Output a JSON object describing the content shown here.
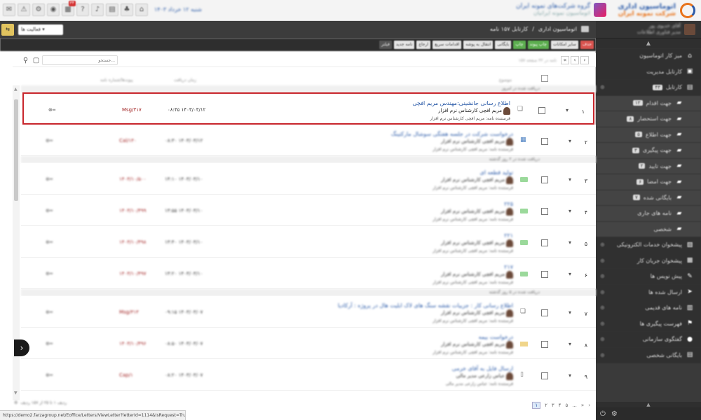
{
  "header": {
    "brand_title": "اتوماسیون اداری",
    "brand_subtitle": "شرکت نمونه ایران",
    "org_title": "گروه شرکت‌های نمونه ایران",
    "org_subtitle": "اتوماسیون نمونه ایرانیان",
    "date_text": "شنبه ۱۲ خرداد ۱۴۰۳",
    "icons": [
      "envelope-icon",
      "network-icon",
      "gear-icon",
      "eye-icon",
      "calendar-icon",
      "help-icon",
      "mic-icon",
      "table-icon",
      "bell-icon",
      "home-icon"
    ],
    "notification_badge": "۳۴"
  },
  "sidebar": {
    "user_name": "آقای خدیوی پور",
    "user_role": "مدیر فناوری اطلاعات",
    "items": [
      {
        "label": "میز کار اتوماسیون",
        "icon": "home-icon",
        "type": "sect"
      },
      {
        "label": "کارتابل مدیریت",
        "icon": "briefcase-icon",
        "type": "sect"
      },
      {
        "label": "کارتابل",
        "icon": "inbox-icon",
        "type": "sect",
        "count": "۴۳"
      },
      {
        "label": "جهت اقدام",
        "icon": "folder-icon",
        "type": "sub",
        "count": "۱۲"
      },
      {
        "label": "جهت استحضار",
        "icon": "folder-icon",
        "type": "sub",
        "count": "۸"
      },
      {
        "label": "جهت اطلاع",
        "icon": "folder-icon",
        "type": "sub",
        "count": "۵"
      },
      {
        "label": "جهت پیگیری",
        "icon": "folder-icon",
        "type": "sub",
        "count": "۳"
      },
      {
        "label": "جهت تایید",
        "icon": "folder-icon",
        "type": "sub",
        "count": "۲"
      },
      {
        "label": "جهت امضا",
        "icon": "folder-icon",
        "type": "sub",
        "count": "۶"
      },
      {
        "label": "بایگانی شده",
        "icon": "folder-icon",
        "type": "sub",
        "count": "۷"
      },
      {
        "label": "نامه های جاری",
        "icon": "folder-icon",
        "type": "sub"
      },
      {
        "label": "شخصی",
        "icon": "folder-icon",
        "type": "sub"
      },
      {
        "label": "پیشخوان خدمات الکترونیکی",
        "icon": "services-icon",
        "type": "sect"
      },
      {
        "label": "پیشخوان جریان کار",
        "icon": "grid-icon",
        "type": "sect"
      },
      {
        "label": "پیش نویس ها",
        "icon": "edit-icon",
        "type": "sect"
      },
      {
        "label": "ارسال شده ها",
        "icon": "send-icon",
        "type": "sect"
      },
      {
        "label": "نامه های قدیمی",
        "icon": "archive-icon",
        "type": "sect"
      },
      {
        "label": "فهرست پیگیری ها",
        "icon": "flag-icon",
        "type": "sect"
      },
      {
        "label": "گفتگوی سازمانی",
        "icon": "chat-icon",
        "type": "sect"
      },
      {
        "label": "بایگانی شخصی",
        "icon": "cabinet-icon",
        "type": "sect"
      }
    ]
  },
  "pathbar": {
    "context_button": "فعالیت ها",
    "crumb1": "اتوماسیون اداری",
    "crumb2": "کارتابل ۱۵۷ نامه"
  },
  "toolbar": {
    "buttons": [
      {
        "label": "فیلتر",
        "style": "dark"
      },
      {
        "label": "نامه جدید",
        "style": "light"
      },
      {
        "label": "ارجاع",
        "style": "light"
      },
      {
        "label": "اقدامات سریع",
        "style": "light"
      },
      {
        "label": "انتقال به پوشه",
        "style": "light"
      },
      {
        "label": "بایگانی",
        "style": "light"
      },
      {
        "label": "چاپ",
        "style": "green"
      },
      {
        "label": "چاپ پیوند",
        "style": "green"
      },
      {
        "label": "سایر امکانات",
        "style": "light"
      },
      {
        "label": "حذف",
        "style": "red"
      }
    ]
  },
  "search": {
    "placeholder": "جستجو...",
    "pager_text": "۱۵۷ نامه در ۳۲ صفحه"
  },
  "columns": {
    "subject": "موضوع",
    "date": "زمان دریافت",
    "number": "پیوندها/شماره نامه"
  },
  "groups": [
    {
      "label": "دریافت شده در امروز"
    },
    {
      "label": "دریافت شده در ۲ روز گذشته"
    },
    {
      "label": "دریافت شده در ۵ روز گذشته"
    }
  ],
  "rows": [
    {
      "num": "۱",
      "title": "اطلاع رسانی جانشینی:مهندس مریم افچی",
      "sender": "مریم افچی کارشناس نرم افزار",
      "from": "فرستنده نامه: مریم افچی کارشناس نرم افزار",
      "date": "۰۸:۴۵ ۱۴۰۳/۰۳/۱۲",
      "code": "Msg/۳۱۷",
      "icon": "eye-open-icon",
      "type": "doc"
    },
    {
      "num": "۲",
      "title": "درخواست شرکت در جلسه هفتگی سوشال مارکتینگ",
      "sender": "مریم افچی کارشناس نرم افزار",
      "from": "فرستنده نامه: مریم افچی کارشناس نرم افزار",
      "date": "۰۸:۳۰ ۱۴۰۳/۰۳/۱۲",
      "code": "Cal/۱۴۰",
      "icon": "eye-open-icon",
      "type": "cal"
    },
    {
      "num": "۳",
      "title": "تولید قطعه ای",
      "sender": "مریم افچی کارشناس نرم افزار",
      "from": "فرستنده نامه: مریم افچی کارشناس نرم افزار",
      "date": "۱۴:۱۰ ۱۴۰۳/۰۳/۱۰",
      "code": "۱۴۰۳/۱۰/۵۰۰",
      "icon": "eye-open-icon",
      "type": "green"
    },
    {
      "num": "۴",
      "title": "۲۲۵",
      "sender": "مریم افچی کارشناس نرم افزار",
      "from": "فرستنده نامه: مریم افچی کارشناس نرم افزار",
      "date": "۱۳:۵۵ ۱۴۰۳/۰۳/۱۰",
      "code": "۱۴۰۳/۱۰/۴۹۹",
      "icon": "eye-open-icon",
      "type": "green"
    },
    {
      "num": "۵",
      "title": "۲۲۱",
      "sender": "مریم افچی کارشناس نرم افزار",
      "from": "فرستنده نامه: مریم افچی کارشناس نرم افزار",
      "date": "۱۳:۴۰ ۱۴۰۳/۰۳/۱۰",
      "code": "۱۴۰۳/۱۰/۴۹۸",
      "icon": "eye-open-icon",
      "type": "green"
    },
    {
      "num": "۶",
      "title": "۲۱۷",
      "sender": "مریم افچی کارشناس نرم افزار",
      "from": "فرستنده نامه: مریم افچی کارشناس نرم افزار",
      "date": "۱۳:۲۰ ۱۴۰۳/۰۳/۱۰",
      "code": "۱۴۰۳/۱۰/۴۹۷",
      "icon": "eye-open-icon",
      "type": "green"
    },
    {
      "num": "۷",
      "title": "اطلاع رسانی کار : جزییات نقشه سنگ های لاک ابلیت هال در پروژه : آرکادیا",
      "sender": "مریم افچی کارشناس نرم افزار",
      "from": "فرستنده نامه: مریم افچی کارشناس نرم افزار",
      "date": "۰۹:۱۵ ۱۴۰۳/۰۳/۰۷",
      "code": "Msg/۳۱۳",
      "icon": "eye-open-icon",
      "type": "doc"
    },
    {
      "num": "۸",
      "title": "درخواست بیمه",
      "sender": "مریم افچی کارشناس نرم افزار",
      "from": "فرستنده نامه: مریم افچی کارشناس نرم افزار",
      "date": "۰۸:۵۰ ۱۴۰۳/۰۳/۰۷",
      "code": "۱۴۰۳/۱۰/۴۹۶",
      "icon": "eye-open-icon",
      "type": "yellow"
    },
    {
      "num": "۹",
      "title": "ارسال فایل به آقای خرمی",
      "sender": "عباس زارعی مدیر مالی",
      "from": "فرستنده نامه: عباس زارعی مدیر مالی",
      "date": "۰۸:۲۰ ۱۴۰۳/۰۳/۰۷",
      "code": "Cap/۱",
      "icon": "eye-open-icon",
      "type": "file"
    }
  ],
  "bottom": {
    "pages": [
      "۱",
      "۲",
      "۳",
      "۴",
      "۵",
      "...",
      "»",
      "›"
    ],
    "active_page": "۱",
    "per_page_text": "ردیف ۱ تا ۲۵ از ۱۵۷ ردیف",
    "status_url": "https://demo2.farzagroup.net/Eoffice/Letters/ViewLetter?letterId=1114&IsRequest=True"
  },
  "colors": {
    "accent": "#2a5aa8",
    "highlight": "#c8262c",
    "sidebar_bg": "#3a3a3a",
    "code_red": "#a02020"
  }
}
